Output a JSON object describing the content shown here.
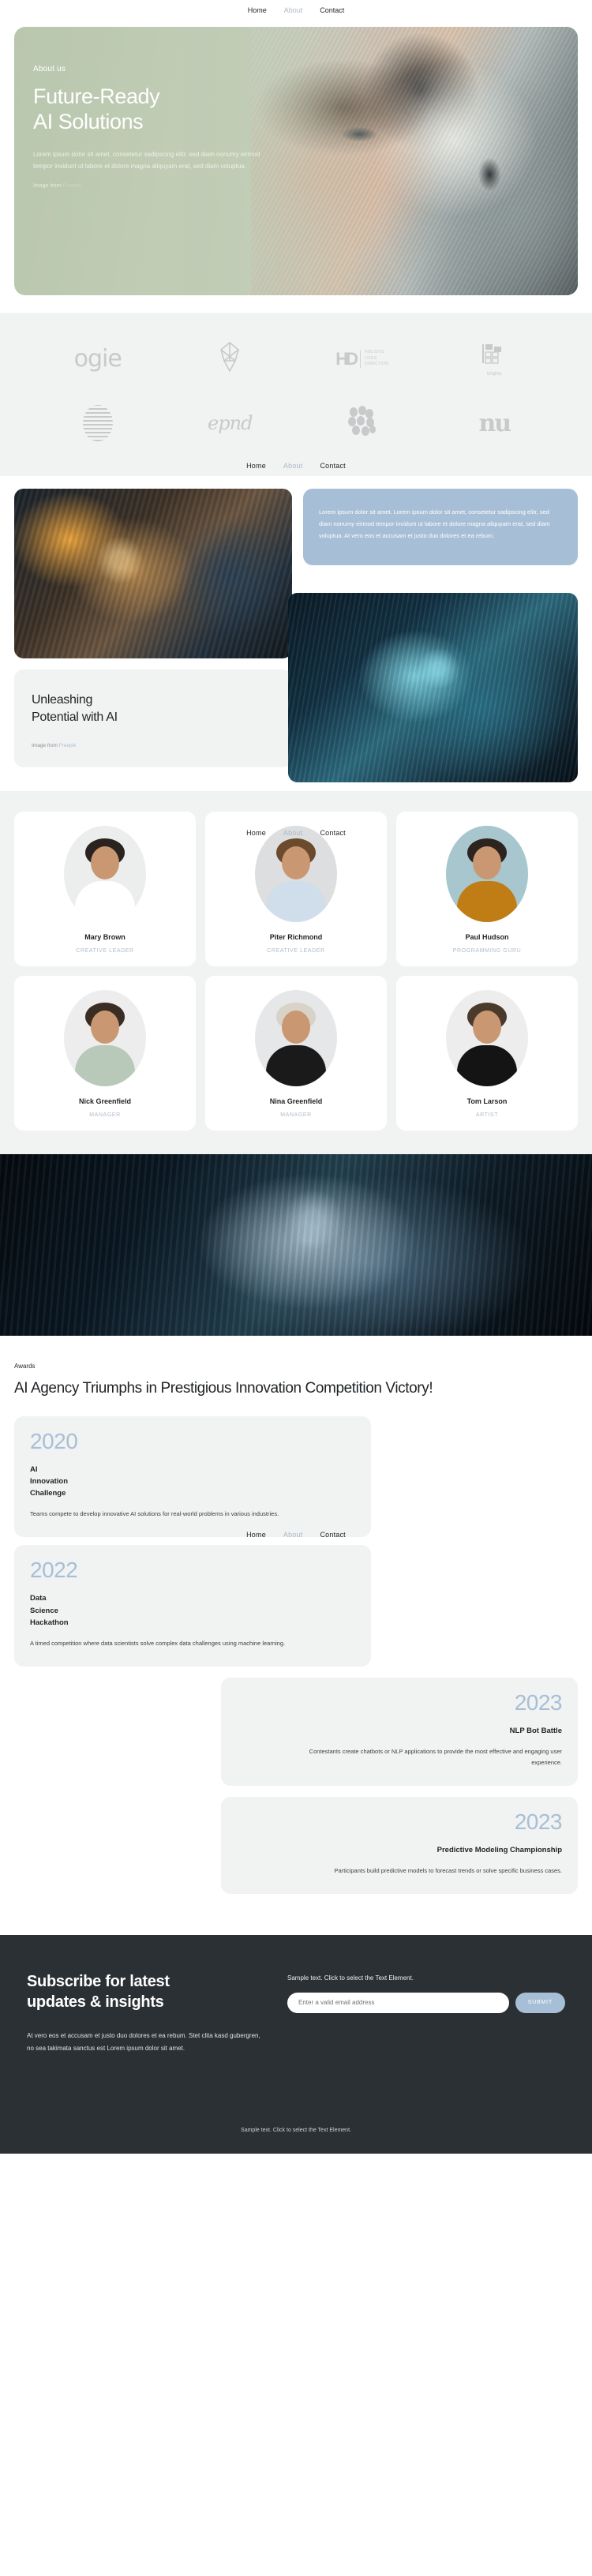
{
  "nav": {
    "items": [
      {
        "label": "Home",
        "state": "active"
      },
      {
        "label": "About",
        "state": "dim"
      },
      {
        "label": "Contact",
        "state": "normal"
      }
    ]
  },
  "hero": {
    "eyebrow": "About us",
    "title_line1": "Future-Ready",
    "title_line2": "AI Solutions",
    "paragraph": "Lorem ipsum dolor sit amet, consetetur sadipscing elitr, sed diam nonumy eirmod tempor invidunt ut labore et dolore magna aliquyam erat, sed diam voluptua.",
    "credit_prefix": "Image from ",
    "credit_link": "Freepik"
  },
  "logos": {
    "items": [
      {
        "name": "ogie",
        "kind": "wordmark"
      },
      {
        "name": "flower-mark",
        "kind": "symbol"
      },
      {
        "name": "HD",
        "sub": "HOLISTIC\nLIFES\nDIRECTION",
        "kind": "hd"
      },
      {
        "name": "brighto",
        "kind": "brighto"
      },
      {
        "name": "striped-oval",
        "kind": "symbol"
      },
      {
        "name": "epnd",
        "kind": "wordmark"
      },
      {
        "name": "dots-mark",
        "kind": "symbol"
      },
      {
        "name": "nu",
        "kind": "wordmark"
      }
    ],
    "hd_mark": "HD",
    "hd_sub_1": "HOLISTIC",
    "hd_sub_2": "LIFES",
    "hd_sub_3": "DIRECTION",
    "brighto_name": "brighto",
    "ogie_text": "ogie",
    "epnd_text": "epnd",
    "nu_text": "nu"
  },
  "split": {
    "blue_card_text": "Lorem ipsum dolor sit amet. Lorem ipsum dolor sit amet, consetetur sadipscing elitr, sed diam nonumy eirmod tempor invidunt ut labore et dolore magna aliquyam erat, sed diam voluptua. At vero eos et accusam et justo duo dolores et ea rebum.",
    "unleash_line1": "Unleashing",
    "unleash_line2": "Potential with AI",
    "credit_prefix": "Image from ",
    "credit_link": "Freepik"
  },
  "team": {
    "members": [
      {
        "name": "Mary Brown",
        "role": "CREATIVE LEADER",
        "hair": "#2a2320",
        "shirt": "#ffffff",
        "bg": "#eceded"
      },
      {
        "name": "Piter Richmond",
        "role": "CREATIVE LEADER",
        "hair": "#6b4a2e",
        "shirt": "#cfdeea",
        "bg": "#dddedf"
      },
      {
        "name": "Paul Hudson",
        "role": "PROGRAMMING GURU",
        "hair": "#2d2420",
        "shirt": "#c07d15",
        "bg": "#a8c6cd"
      },
      {
        "name": "Nick Greenfield",
        "role": "MANAGER",
        "hair": "#3a2d24",
        "shirt": "#b9c9b9",
        "bg": "#ededed"
      },
      {
        "name": "Nina Greenfield",
        "role": "MANAGER",
        "hair": "#d8d2c9",
        "shirt": "#1a1a1a",
        "bg": "#e6e7e8"
      },
      {
        "name": "Tom Larson",
        "role": "ARTIST",
        "hair": "#4a3a2c",
        "shirt": "#141414",
        "bg": "#ededed"
      }
    ]
  },
  "awards": {
    "eyebrow": "Awards",
    "title": "AI Agency Triumphs in Prestigious Innovation Competition Victory!",
    "cards": [
      {
        "year": "2020",
        "name": "AI\nInnovation\nChallenge",
        "name_l1": "AI",
        "name_l2": "Innovation",
        "name_l3": "Challenge",
        "desc": "Teams compete to develop innovative AI solutions for real-world problems in various industries.",
        "align": "left"
      },
      {
        "year": "2022",
        "name_l1": "Data",
        "name_l2": "Science",
        "name_l3": "Hackathon",
        "desc": "A timed competition where data scientists solve complex data challenges using machine learning.",
        "align": "left"
      },
      {
        "year": "2023",
        "name_l1": "NLP Bot Battle",
        "name_l2": "",
        "name_l3": "",
        "desc": "Contestants create chatbots or NLP applications to provide the most effective and engaging user experience.",
        "align": "right"
      },
      {
        "year": "2023",
        "name_l1": "Predictive Modeling Championship",
        "name_l2": "",
        "name_l3": "",
        "desc": "Participants build predictive models to forecast trends or solve specific business cases.",
        "align": "right"
      }
    ]
  },
  "footer": {
    "title_l1": "Subscribe for latest",
    "title_l2": "updates & insights",
    "paragraph": "At vero eos et accusam et justo duo dolores et ea rebum. Stet clita kasd gubergren, no sea takimata sanctus est Lorem ipsum dolor sit amet.",
    "sample_text": "Sample text. Click to select the Text Element.",
    "email_placeholder": "Enter a valid email address",
    "submit_label": "SUBMIT",
    "bottom_text": "Sample text. Click to select the Text Element.",
    "accent_color": "#a7bfd6",
    "bg_color": "#2b3034"
  }
}
